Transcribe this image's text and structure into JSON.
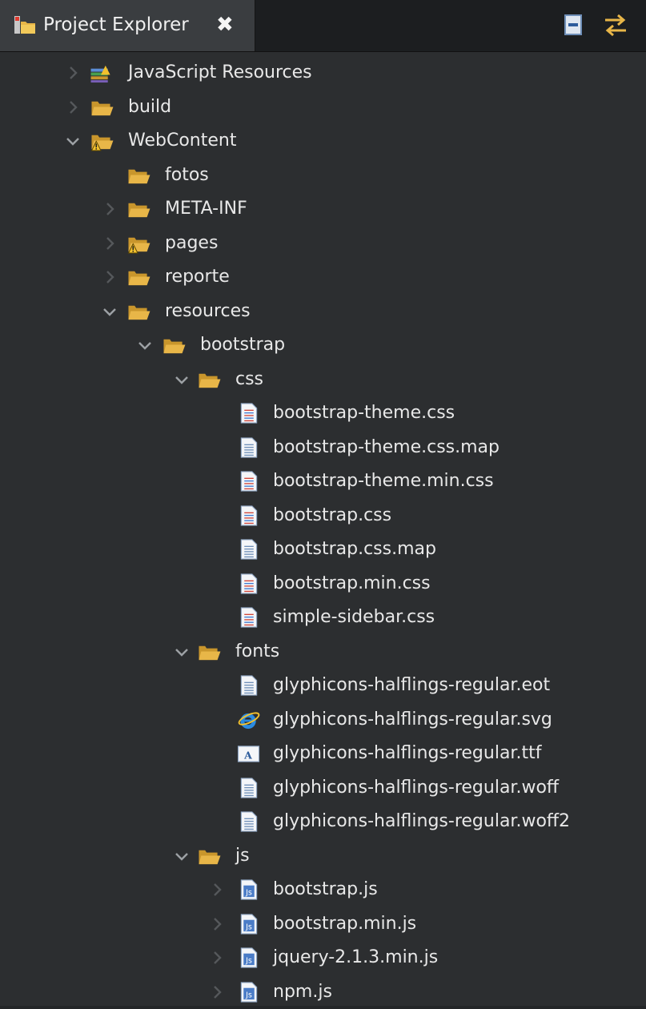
{
  "tab": {
    "title": "Project Explorer",
    "close_label": "✖"
  },
  "toolbar": {
    "collapse_all": "collapse-all-icon",
    "link_editor": "link-with-editor-icon"
  },
  "tree": [
    {
      "label": "JavaScript Resources",
      "depth": 0,
      "chevron": "collapsed",
      "icon": "library-icon"
    },
    {
      "label": "build",
      "depth": 0,
      "chevron": "collapsed",
      "icon": "folder-icon"
    },
    {
      "label": "WebContent",
      "depth": 0,
      "chevron": "expanded",
      "icon": "folder-warning-icon"
    },
    {
      "label": "fotos",
      "depth": 1,
      "chevron": "none",
      "icon": "folder-icon"
    },
    {
      "label": "META-INF",
      "depth": 1,
      "chevron": "collapsed",
      "icon": "folder-icon"
    },
    {
      "label": "pages",
      "depth": 1,
      "chevron": "collapsed",
      "icon": "folder-warning-icon"
    },
    {
      "label": "reporte",
      "depth": 1,
      "chevron": "collapsed",
      "icon": "folder-icon"
    },
    {
      "label": "resources",
      "depth": 1,
      "chevron": "expanded",
      "icon": "folder-icon"
    },
    {
      "label": "bootstrap",
      "depth": 2,
      "chevron": "expanded",
      "icon": "folder-icon"
    },
    {
      "label": "css",
      "depth": 3,
      "chevron": "expanded",
      "icon": "folder-icon"
    },
    {
      "label": "bootstrap-theme.css",
      "depth": 4,
      "chevron": "none",
      "icon": "css-file-icon"
    },
    {
      "label": "bootstrap-theme.css.map",
      "depth": 4,
      "chevron": "none",
      "icon": "text-file-icon"
    },
    {
      "label": "bootstrap-theme.min.css",
      "depth": 4,
      "chevron": "none",
      "icon": "css-file-icon"
    },
    {
      "label": "bootstrap.css",
      "depth": 4,
      "chevron": "none",
      "icon": "css-file-icon"
    },
    {
      "label": "bootstrap.css.map",
      "depth": 4,
      "chevron": "none",
      "icon": "text-file-icon"
    },
    {
      "label": "bootstrap.min.css",
      "depth": 4,
      "chevron": "none",
      "icon": "css-file-icon"
    },
    {
      "label": "simple-sidebar.css",
      "depth": 4,
      "chevron": "none",
      "icon": "css-file-icon"
    },
    {
      "label": "fonts",
      "depth": 3,
      "chevron": "expanded",
      "icon": "folder-icon"
    },
    {
      "label": "glyphicons-halflings-regular.eot",
      "depth": 4,
      "chevron": "none",
      "icon": "text-file-icon"
    },
    {
      "label": "glyphicons-halflings-regular.svg",
      "depth": 4,
      "chevron": "none",
      "icon": "ie-file-icon"
    },
    {
      "label": "glyphicons-halflings-regular.ttf",
      "depth": 4,
      "chevron": "none",
      "icon": "font-file-icon"
    },
    {
      "label": "glyphicons-halflings-regular.woff",
      "depth": 4,
      "chevron": "none",
      "icon": "text-file-icon"
    },
    {
      "label": "glyphicons-halflings-regular.woff2",
      "depth": 4,
      "chevron": "none",
      "icon": "text-file-icon"
    },
    {
      "label": "js",
      "depth": 3,
      "chevron": "expanded",
      "icon": "folder-icon"
    },
    {
      "label": "bootstrap.js",
      "depth": 4,
      "chevron": "collapsed",
      "icon": "js-file-icon"
    },
    {
      "label": "bootstrap.min.js",
      "depth": 4,
      "chevron": "collapsed",
      "icon": "js-file-icon"
    },
    {
      "label": "jquery-2.1.3.min.js",
      "depth": 4,
      "chevron": "collapsed",
      "icon": "js-file-icon"
    },
    {
      "label": "npm.js",
      "depth": 4,
      "chevron": "collapsed",
      "icon": "js-file-icon"
    }
  ],
  "colors": {
    "folder": "#e8b648",
    "chevron": "#6f7275",
    "js_badge": "#4a7cc7",
    "css_red": "#d0463a"
  }
}
